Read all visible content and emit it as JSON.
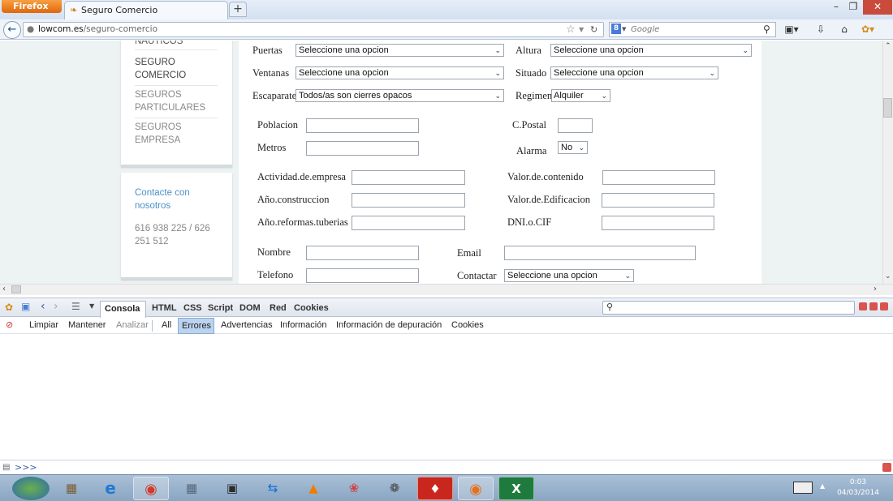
{
  "browser": {
    "menu_button": "Firefox",
    "tab_title": "Seguro Comercio",
    "url_host": "lowcom.es",
    "url_path": "/seguro-comercio",
    "search_placeholder": "Google"
  },
  "sidebar": {
    "cut_item": "NÁUTICOS",
    "items": [
      {
        "line1": "SEGURO",
        "line2": "COMERCIO"
      },
      {
        "line1": "SEGUROS",
        "line2": "PARTICULARES"
      },
      {
        "line1": "SEGUROS",
        "line2": "EMPRESA"
      }
    ],
    "contact_title_1": "Contacte con",
    "contact_title_2": "nosotros",
    "phone_1": "616 938 225 / 626",
    "phone_2": "251 512"
  },
  "form": {
    "puertas": {
      "label": "Puertas",
      "value": "Seleccione una opcion"
    },
    "altura": {
      "label": "Altura",
      "value": "Seleccione una opcion"
    },
    "ventanas": {
      "label": "Ventanas",
      "value": "Seleccione una opcion"
    },
    "situado": {
      "label": "Situado",
      "value": "Seleccione una opcion"
    },
    "escaparate": {
      "label": "Escaparate",
      "value": "Todos/as son cierres opacos"
    },
    "regimen": {
      "label": "Regimen",
      "value": "Alquiler"
    },
    "poblacion": {
      "label": "Poblacion"
    },
    "cpostal": {
      "label": "C.Postal"
    },
    "metros": {
      "label": "Metros"
    },
    "alarma": {
      "label": "Alarma",
      "value": "No"
    },
    "actividad": {
      "label": "Actividad.de.empresa"
    },
    "valor_contenido": {
      "label": "Valor.de.contenido"
    },
    "ano_construccion": {
      "label": "Año.construccion"
    },
    "valor_edificacion": {
      "label": "Valor.de.Edificacion"
    },
    "ano_reformas": {
      "label": "Año.reformas.tuberias"
    },
    "dni": {
      "label": "DNI.o.CIF"
    },
    "nombre": {
      "label": "Nombre"
    },
    "email": {
      "label": "Email"
    },
    "telefono": {
      "label": "Telefono"
    },
    "contactar": {
      "label": "Contactar",
      "value": "Seleccione una opcion"
    }
  },
  "firebug": {
    "tabs": [
      "Consola",
      "HTML",
      "CSS",
      "Script",
      "DOM",
      "Red",
      "Cookies"
    ],
    "filters": [
      "Limpiar",
      "Mantener",
      "Analizar",
      "All",
      "Errores",
      "Advertencias",
      "Información",
      "Información de depuración",
      "Cookies"
    ],
    "prompt": ">>>"
  },
  "taskbar": {
    "time": "0:03",
    "date": "04/03/2014"
  },
  "colors": {
    "accent": "#e0660c",
    "contact_link": "#4a90c8",
    "close_button": "#c94b3c"
  }
}
